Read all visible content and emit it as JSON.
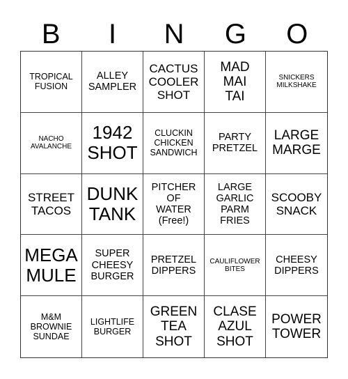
{
  "header": {
    "letters": [
      "B",
      "I",
      "N",
      "G",
      "O"
    ]
  },
  "cells": [
    {
      "text": "TROPICAL\nFUSION",
      "size": "s-sm"
    },
    {
      "text": "ALLEY\nSAMPLER",
      "size": "s-md"
    },
    {
      "text": "CACTUS\nCOOLER\nSHOT",
      "size": "s-lg"
    },
    {
      "text": "MAD\nMAI\nTAI",
      "size": "s-xl"
    },
    {
      "text": "SNICKERS\nMILKSHAKE",
      "size": "s-xs"
    },
    {
      "text": "NACHO\nAVALANCHE",
      "size": "s-xs"
    },
    {
      "text": "1942\nSHOT",
      "size": "s-xxl"
    },
    {
      "text": "CLUCKIN\nCHICKEN\nSANDWICH",
      "size": "s-sm"
    },
    {
      "text": "PARTY\nPRETZEL",
      "size": "s-md"
    },
    {
      "text": "LARGE\nMARGE",
      "size": "s-xl"
    },
    {
      "text": "STREET\nTACOS",
      "size": "s-lg"
    },
    {
      "text": "DUNK\nTANK",
      "size": "s-xxl"
    },
    {
      "text": "PITCHER\nOF\nWATER\n(Free!)",
      "size": "s-md"
    },
    {
      "text": "LARGE\nGARLIC\nPARM\nFRIES",
      "size": "s-md"
    },
    {
      "text": "SCOOBY\nSNACK",
      "size": "s-lg"
    },
    {
      "text": "MEGA\nMULE",
      "size": "s-xxl"
    },
    {
      "text": "SUPER\nCHEESY\nBURGER",
      "size": "s-md"
    },
    {
      "text": "PRETZEL\nDIPPERS",
      "size": "s-md"
    },
    {
      "text": "CAULIFLOWER\nBITES",
      "size": "s-xs"
    },
    {
      "text": "CHEESY\nDIPPERS",
      "size": "s-md"
    },
    {
      "text": "M&M\nBROWNIE\nSUNDAE",
      "size": "s-sm"
    },
    {
      "text": "LIGHTLIFE\nBURGER",
      "size": "s-sm"
    },
    {
      "text": "GREEN\nTEA\nSHOT",
      "size": "s-xl"
    },
    {
      "text": "CLASE\nAZUL\nSHOT",
      "size": "s-xl"
    },
    {
      "text": "POWER\nTOWER",
      "size": "s-xl"
    }
  ]
}
